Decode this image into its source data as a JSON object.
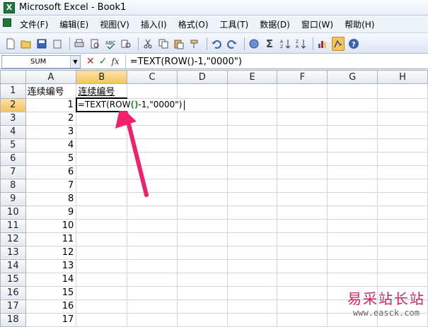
{
  "window": {
    "title": "Microsoft Excel - Book1",
    "app_icon": "excel-icon"
  },
  "menu": [
    "文件(F)",
    "编辑(E)",
    "视图(V)",
    "插入(I)",
    "格式(O)",
    "工具(T)",
    "数据(D)",
    "窗口(W)",
    "帮助(H)"
  ],
  "toolbar": {
    "icons": [
      "new-icon",
      "open-icon",
      "save-icon",
      "permission-icon",
      "print-icon",
      "print-preview-icon",
      "spelling-icon",
      "research-icon",
      "cut-icon",
      "copy-icon",
      "paste-icon",
      "format-painter-icon",
      "undo-icon",
      "redo-icon",
      "hyperlink-icon",
      "autosum-icon",
      "sort-ascending-icon",
      "sort-descending-icon",
      "chart-wizard-icon",
      "drawing-icon",
      "help-icon"
    ],
    "autosum_glyph": "Σ"
  },
  "formula_bar": {
    "name_box": "SUM",
    "cancel": "✕",
    "enter": "✓",
    "fx": "fx",
    "formula": "=TEXT(ROW()-1,\"0000\")"
  },
  "sheet": {
    "columns": [
      "A",
      "B",
      "C",
      "D",
      "E",
      "F",
      "G",
      "H"
    ],
    "rows": [
      "1",
      "2",
      "3",
      "4",
      "5",
      "6",
      "7",
      "8",
      "9",
      "10",
      "11",
      "12",
      "13",
      "14",
      "15",
      "16",
      "17",
      "18"
    ],
    "header_a": "连续编号",
    "header_b": "连续编号",
    "a_values": [
      "1",
      "2",
      "3",
      "4",
      "5",
      "6",
      "7",
      "8",
      "9",
      "10",
      "11",
      "12",
      "13",
      "14",
      "15",
      "16",
      "17"
    ],
    "editing_cell": {
      "ref": "B2",
      "prefix": "=TEXT(ROW",
      "paren": "()",
      "suffix": "-1,\"0000\")"
    }
  },
  "watermark": {
    "cn": "易采站长站",
    "url": "www.easck.com"
  },
  "colors": {
    "accent_arrow": "#f0206a",
    "paren_highlight": "#1b9a2a",
    "selection_header": "#f4c25e"
  }
}
